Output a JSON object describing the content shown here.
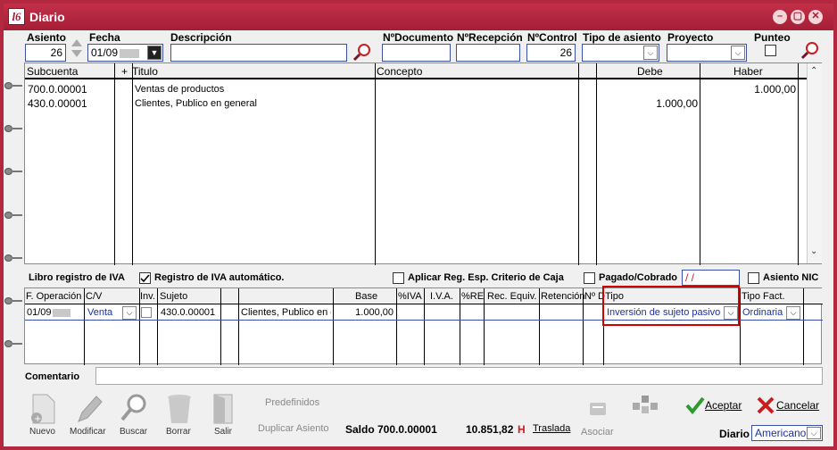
{
  "window": {
    "app_icon": "l6-logo-icon",
    "app_icon_text": "l6",
    "title": "Diario",
    "min": "–",
    "restore": "▢",
    "close": "✕"
  },
  "header": {
    "asiento_label": "Asiento",
    "asiento_value": "26",
    "fecha_label": "Fecha",
    "fecha_value": "01/09",
    "descripcion_label": "Descripción",
    "descripcion_value": "",
    "ndocumento_label": "NºDocumento",
    "ndocumento_value": "",
    "nrecepcion_label": "NºRecepción",
    "nrecepcion_value": "",
    "ncontrol_label": "NºControl",
    "ncontrol_value": "26",
    "tipo_asiento_label": "Tipo de asiento",
    "tipo_asiento_value": "",
    "proyecto_label": "Proyecto",
    "proyecto_value": "",
    "punteo_label": "Punteo"
  },
  "entries": {
    "columns": {
      "subcuenta": "Subcuenta",
      "plus": "+",
      "titulo": "Titulo",
      "concepto": "Concepto",
      "debe": "Debe",
      "haber": "Haber"
    },
    "rows": [
      {
        "subcuenta": "700.0.00001",
        "titulo": "Ventas de productos",
        "concepto": "",
        "debe": "",
        "haber": "1.000,00"
      },
      {
        "subcuenta": "430.0.00001",
        "titulo": "Clientes, Publico en general",
        "concepto": "",
        "debe": "1.000,00",
        "haber": ""
      }
    ]
  },
  "iva": {
    "libro_label": "Libro registro de IVA",
    "registro_auto_label": "Registro de IVA automático.",
    "aplicar_label": "Aplicar Reg. Esp. Criterio de Caja",
    "pagado_label": "Pagado/Cobrado",
    "pagado_value": " / /",
    "asiento_nic_label": "Asiento NIC",
    "columns": {
      "f_operacion": "F. Operación",
      "cv": "C/V",
      "inv": "Inv.",
      "sujeto": "Sujeto",
      "base": "Base",
      "piva": "%IVA",
      "iva": "I.V.A.",
      "pre": "%RE",
      "rec_equiv": "Rec. Equiv.",
      "retencion": "Retención",
      "nd": "Nº D",
      "tipo": "Tipo",
      "tipo_fact": "Tipo Fact."
    },
    "row": {
      "f_operacion": "01/09",
      "cv": "Venta",
      "sujeto": "430.0.00001",
      "nombre": "Clientes, Publico en g",
      "base": "1.000,00",
      "tipo": "Inversión de sujeto pasivo",
      "tipo_fact": "Ordinaria"
    }
  },
  "comentario": {
    "label": "Comentario",
    "value": ""
  },
  "toolbar": {
    "nuevo": "Nuevo",
    "modificar": "Modificar",
    "buscar": "Buscar",
    "borrar": "Borrar",
    "salir": "Salir",
    "predefinidos": "Predefinidos",
    "duplicar": "Duplicar Asiento",
    "saldo_label": "Saldo 700.0.00001",
    "saldo_value": "10.851,82",
    "saldo_flag": "H",
    "traslada": "Traslada",
    "asociar": "Asociar",
    "aceptar": "Aceptar",
    "cancelar": "Cancelar",
    "diario_label": "Diario",
    "diario_value": "Americano"
  },
  "colors": {
    "frame": "#b3283e",
    "field_border": "#3a4fa6",
    "highlight": "#d40000",
    "accept_green": "#2e9b2e",
    "cancel_red": "#c81e1e"
  }
}
